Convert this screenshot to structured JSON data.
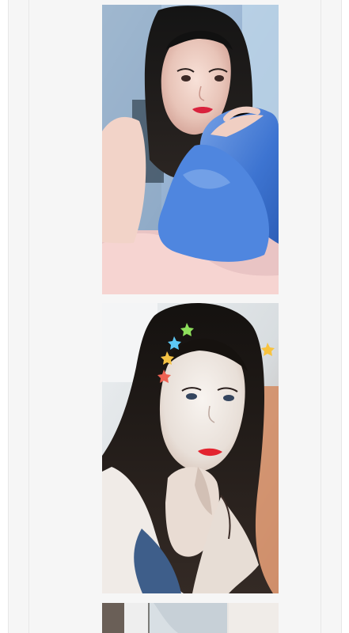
{
  "gallery": {
    "images": [
      {
        "name": "selfie-blue-pillow",
        "icon": "photo-image"
      },
      {
        "name": "selfie-star-hairclips",
        "icon": "photo-image"
      },
      {
        "name": "partial-room-photo",
        "icon": "photo-image"
      }
    ]
  }
}
